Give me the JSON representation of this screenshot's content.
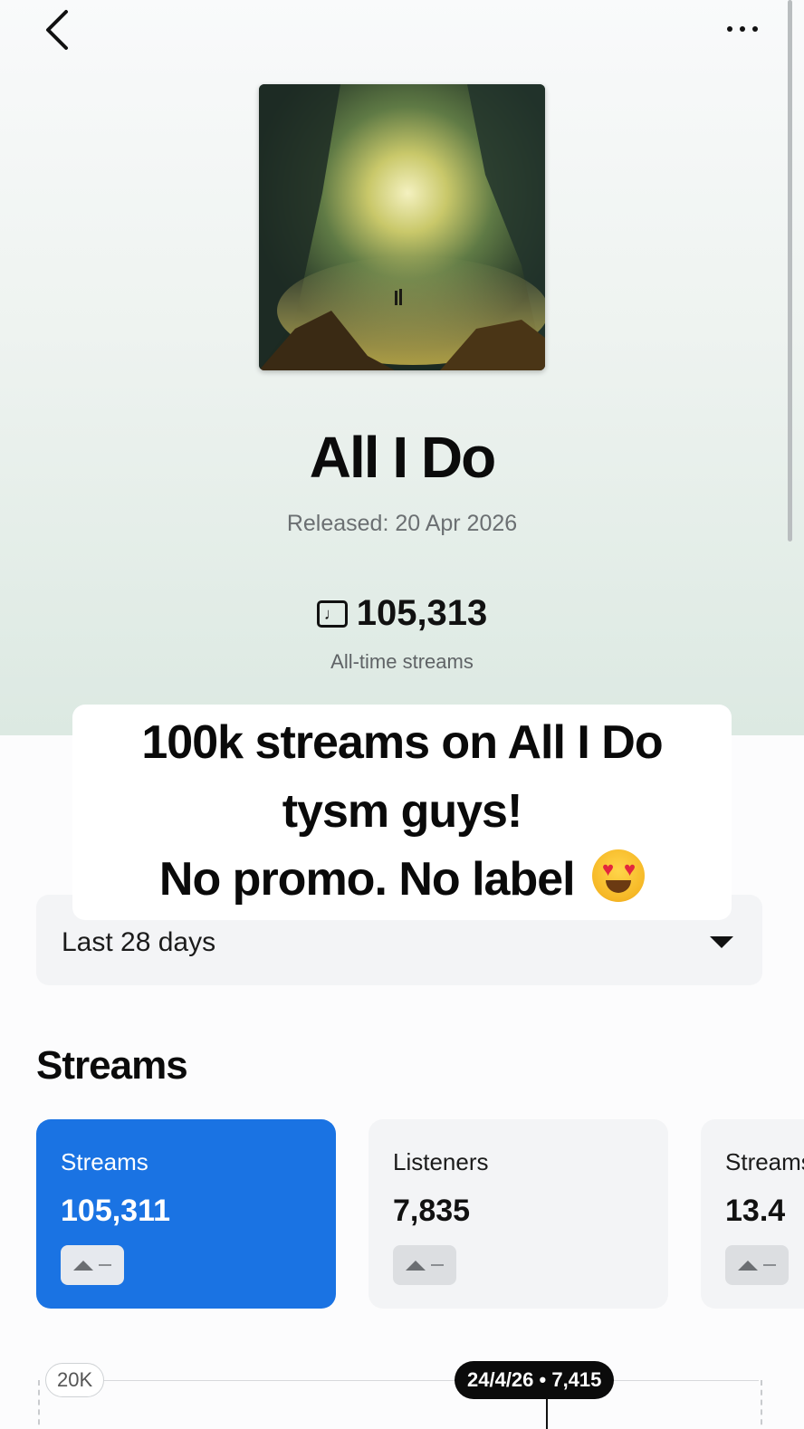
{
  "nav": {
    "back_icon": "chevron-left-icon",
    "more_icon": "more-horizontal-icon"
  },
  "track": {
    "title": "All I Do",
    "released": "Released: 20 Apr 2026",
    "all_time_streams": "105,313",
    "all_time_caption": "All-time streams",
    "stream_icon": "music-note-icon",
    "stream_icon_glyph": "♩"
  },
  "overlay_caption": {
    "line1": "100k streams on All I Do",
    "line2": "tysm guys!",
    "line3": "No promo. No label",
    "emoji": "heart-eyes-emoji"
  },
  "range": {
    "label": "Last 28 days"
  },
  "section": {
    "title": "Streams"
  },
  "stats": [
    {
      "label": "Streams",
      "value": "105,311",
      "trend": "—",
      "active": true
    },
    {
      "label": "Listeners",
      "value": "7,835",
      "trend": "—",
      "active": false
    },
    {
      "label": "Streams / listener",
      "value": "13.4",
      "trend": "—",
      "active": false
    }
  ],
  "chart": {
    "y_tick": "20K",
    "tooltip": "24/4/26 • 7,415"
  },
  "colors": {
    "accent": "#1a73e3",
    "hero_gradient_end": "#dce9e2"
  }
}
